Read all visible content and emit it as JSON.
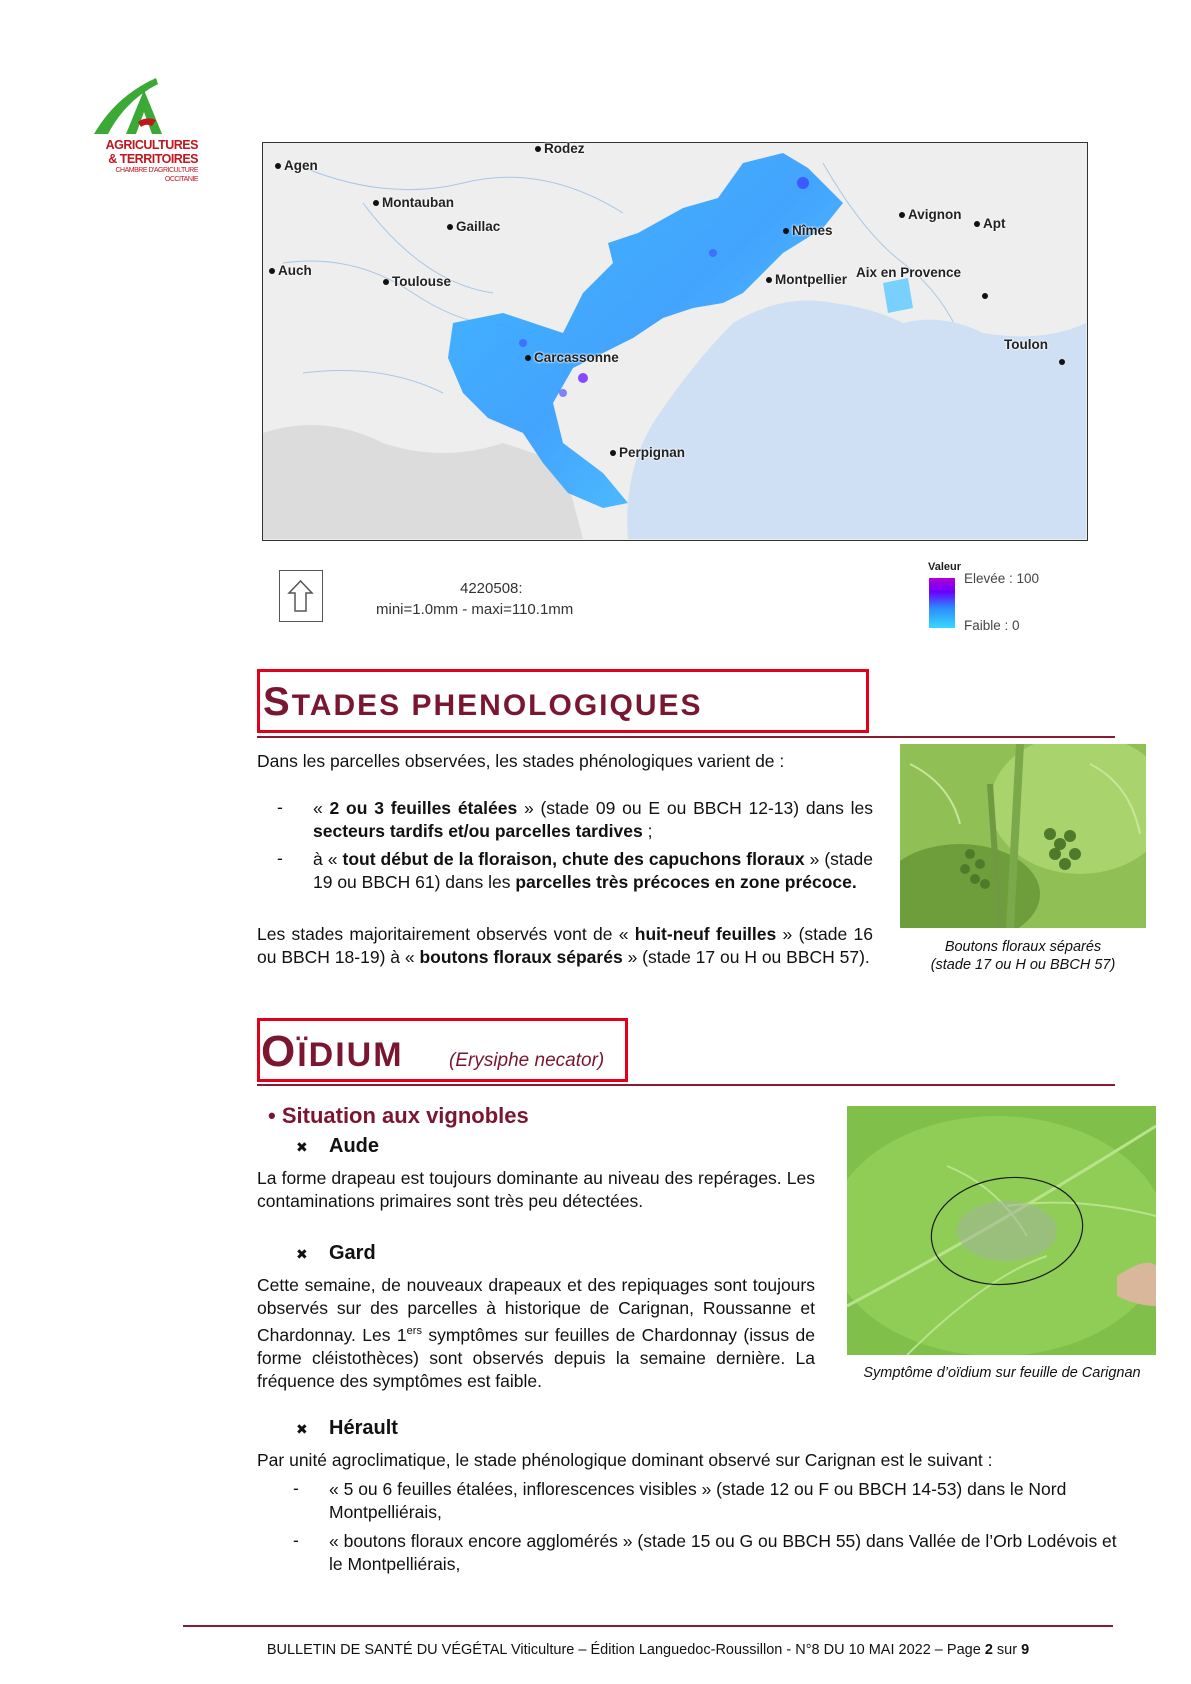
{
  "logo": {
    "line1": "AGRICULTURES",
    "line2": "& TERRITOIRES",
    "line3": "CHAMBRE D'AGRICULTURE",
    "line4": "OCCITANIE"
  },
  "map": {
    "cities": [
      "Rodez",
      "Agen",
      "Montauban",
      "Gaillac",
      "Auch",
      "Toulouse",
      "Nîmes",
      "Avignon",
      "Apt",
      "Montpellier",
      "Aix en Provence",
      "Toulon",
      "Carcassonne",
      "Perpignan"
    ],
    "id_label": "4220508:",
    "range_label": "mini=1.0mm  -  maxi=110.1mm",
    "legend_title": "Valeur",
    "legend_high": "Elevée : 100",
    "legend_low": "Faible : 0",
    "colors": {
      "high": "#b300d9",
      "mid": "#2b8cff",
      "low": "#38d8ff",
      "sea": "#cfe0f4",
      "land": "#ececec"
    }
  },
  "stades": {
    "title_first": "S",
    "title_rest": "TADES PHENOLOGIQUES",
    "intro": "Dans les parcelles observées, les stades phénologiques varient de :",
    "item1": {
      "q1": "« ",
      "b1": "2 ou 3 feuilles étalées",
      "t1": " » (stade 09 ou E ou BBCH 12-13) dans les ",
      "b2": "secteurs tardifs et/ou parcelles tardives",
      "t2": " ;"
    },
    "item2": {
      "t0": "à « ",
      "b1": "tout début de la floraison, chute des capuchons floraux",
      "t1": " » (stade 19 ou BBCH 61) dans les ",
      "b2": "parcelles très précoces en zone précoce."
    },
    "summary": {
      "t0": "Les stades majoritairement observés vont de « ",
      "b1": "huit-neuf feuilles",
      "t1": " » (stade 16 ou BBCH 18-19) à « ",
      "b2": "boutons floraux séparés",
      "t2": " » (stade 17 ou H ou BBCH 57)."
    },
    "photo_caption_1": "Boutons floraux séparés",
    "photo_caption_2": "(stade 17 ou H ou BBCH 57)"
  },
  "oidium": {
    "title_first": "O",
    "title_rest": "ÏDIUM",
    "latin": "(Erysiphe necator)",
    "situation": "Situation aux vignobles",
    "aude": {
      "label": "Aude",
      "text": "La forme drapeau est toujours dominante au niveau des repérages. Les contaminations primaires sont très peu détectées."
    },
    "gard": {
      "label": "Gard",
      "t0": "Cette semaine, de nouveaux drapeaux et des repiquages sont toujours observés sur des parcelles à historique de Carignan, Roussanne et Chardonnay. Les 1",
      "sup": "ers",
      "t1": " symptômes sur feuilles de Chardonnay (issus de forme cléistothèces) sont observés depuis la semaine dernière. La fréquence des symptômes est faible."
    },
    "herault": {
      "label": "Hérault",
      "intro": "Par unité agroclimatique, le stade phénologique dominant observé sur Carignan est le suivant :",
      "item1": "« 5 ou 6 feuilles étalées, inflorescences visibles » (stade 12 ou F ou BBCH 14-53) dans le Nord Montpelliérais,",
      "item2": "« boutons floraux encore agglomérés » (stade 15 ou G ou BBCH 55) dans Vallée de l’Orb Lodévois et le Montpelliérais,"
    },
    "photo_caption": "Symptôme d’oïdium sur feuille de Carignan"
  },
  "footer": {
    "t0": "BULLETIN DE SANTÉ DU VÉGÉTAL Viticulture – Édition Languedoc-Roussillon - N°8 DU 10 MAI 2022 – Page ",
    "page": "2",
    "t1": " sur ",
    "total": "9"
  }
}
